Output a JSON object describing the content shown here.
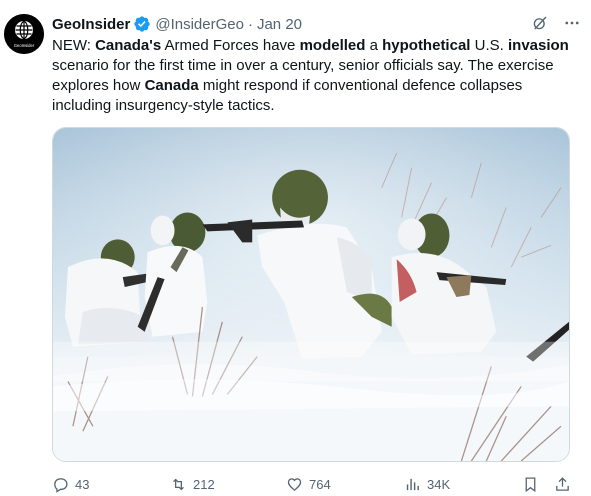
{
  "author": {
    "display_name": "GeoInsider",
    "handle": "@InsiderGeo",
    "separator": "·",
    "date": "Jan 20",
    "avatar_text": "GeoInsider",
    "verified_color": "#1d9bf0"
  },
  "tweet": {
    "segments": [
      {
        "text": "NEW: ",
        "bold": false
      },
      {
        "text": "Canada's",
        "bold": true
      },
      {
        "text": " Armed Forces have ",
        "bold": false
      },
      {
        "text": "modelled",
        "bold": true
      },
      {
        "text": " a ",
        "bold": false
      },
      {
        "text": "hypothetical",
        "bold": true
      },
      {
        "text": " U.S. ",
        "bold": false
      },
      {
        "text": "invasion",
        "bold": true
      },
      {
        "text": " scenario for the first time in over a century, senior officials say. The exercise explores how ",
        "bold": false
      },
      {
        "text": "Canada",
        "bold": true
      },
      {
        "text": " might respond if conventional defence collapses including insurgency-style tactics.",
        "bold": false
      }
    ]
  },
  "media": {
    "image_name": "soldiers-in-winter-camouflage-photo"
  },
  "actions": {
    "replies": "43",
    "reposts": "212",
    "likes": "764",
    "views": "34K"
  },
  "icons": {
    "grok": "grok-icon",
    "more": "more-icon",
    "reply": "reply-icon",
    "repost": "repost-icon",
    "like": "heart-icon",
    "views": "views-icon",
    "bookmark": "bookmark-icon",
    "share": "share-icon"
  },
  "colors": {
    "text": "#0f1419",
    "muted": "#536471",
    "accent": "#1d9bf0"
  }
}
